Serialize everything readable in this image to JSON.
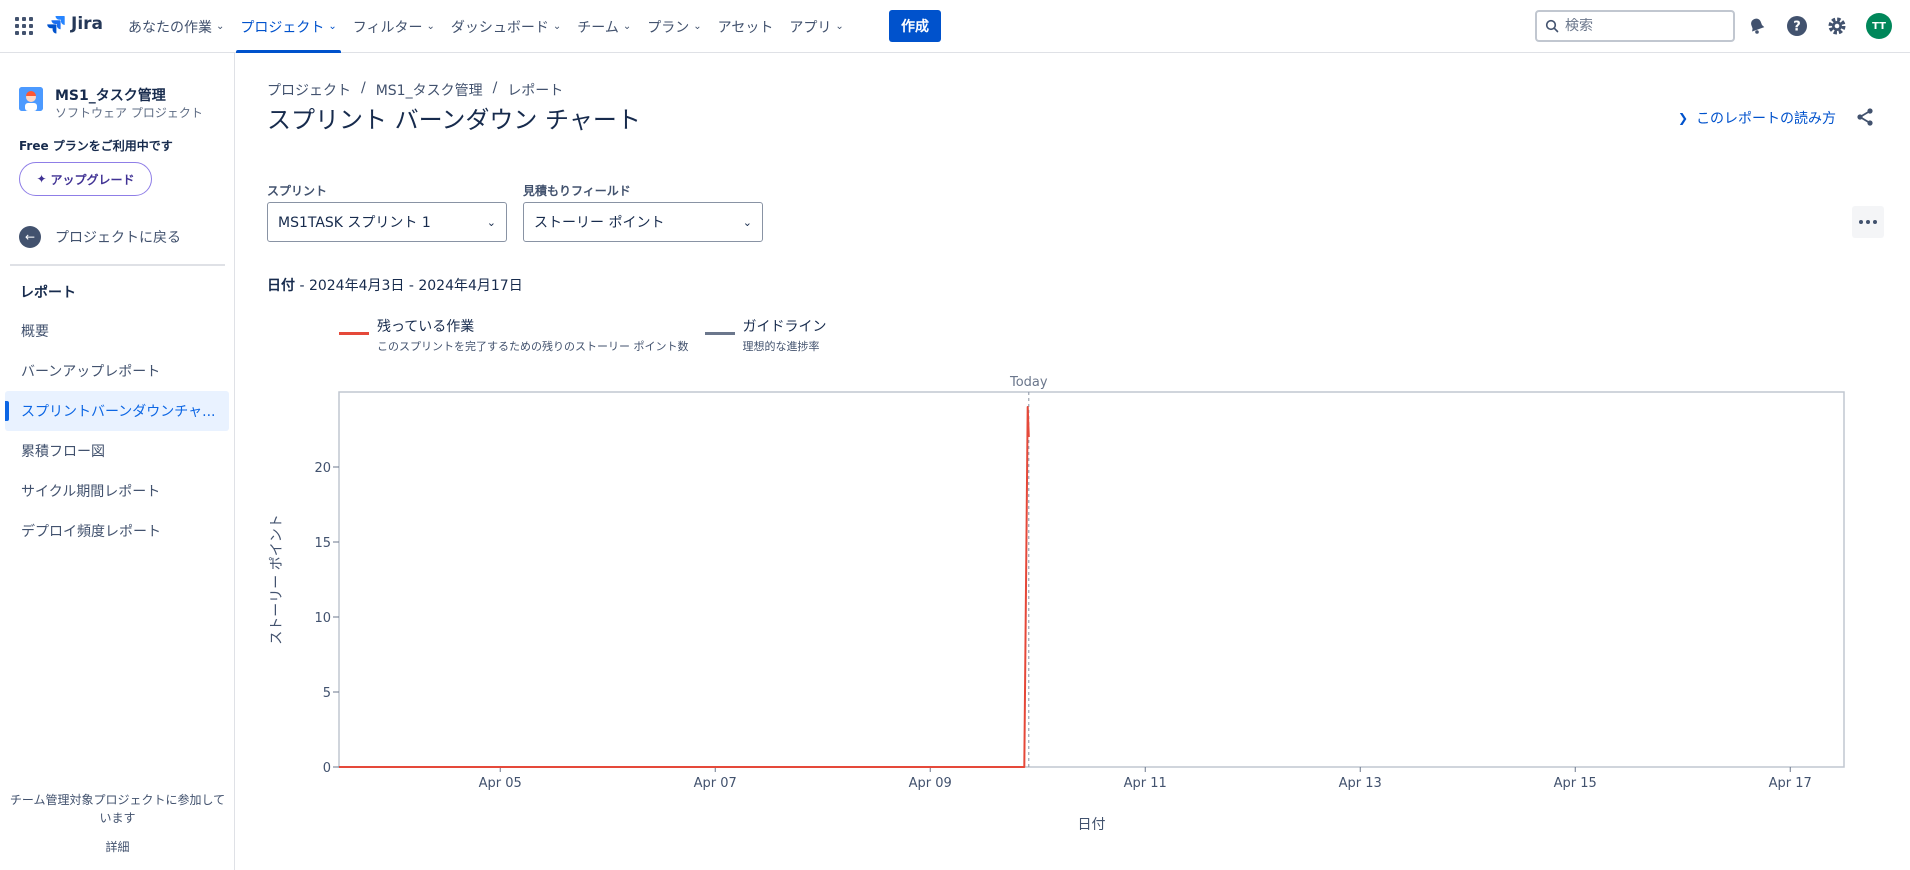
{
  "topnav": {
    "product": "Jira",
    "items": [
      {
        "label": "あなたの作業",
        "chevron": true,
        "active": false
      },
      {
        "label": "プロジェクト",
        "chevron": true,
        "active": true
      },
      {
        "label": "フィルター",
        "chevron": true,
        "active": false
      },
      {
        "label": "ダッシュボード",
        "chevron": true,
        "active": false
      },
      {
        "label": "チーム",
        "chevron": true,
        "active": false
      },
      {
        "label": "プラン",
        "chevron": true,
        "active": false
      },
      {
        "label": "アセット",
        "chevron": false,
        "active": false
      },
      {
        "label": "アプリ",
        "chevron": true,
        "active": false
      }
    ],
    "create_label": "作成",
    "search_placeholder": "検索",
    "avatar_initials": "TT",
    "icons": [
      "app-switcher-icon",
      "jira-logo-icon",
      "notification-bell-icon",
      "help-icon",
      "settings-icon"
    ]
  },
  "sidebar": {
    "project_name": "MS1_タスク管理",
    "project_type": "ソフトウェア プロジェクト",
    "plan_text": "Free プランをご利用中です",
    "upgrade_label": "アップグレード",
    "back_label": "プロジェクトに戻る",
    "section_heading": "レポート",
    "items": [
      {
        "label": "概要",
        "active": false
      },
      {
        "label": "バーンアップレポート",
        "active": false
      },
      {
        "label": "スプリントバーンダウンチャ...",
        "active": true
      },
      {
        "label": "累積フロー図",
        "active": false
      },
      {
        "label": "サイクル期間レポート",
        "active": false
      },
      {
        "label": "デプロイ頻度レポート",
        "active": false
      }
    ],
    "footer_text": "チーム管理対象プロジェクトに参加しています",
    "footer_link": "詳細"
  },
  "main": {
    "breadcrumb": [
      "プロジェクト",
      "MS1_タスク管理",
      "レポート"
    ],
    "title": "スプリント バーンダウン チャート",
    "help_link": "このレポートの読み方",
    "sprint_label": "スプリント",
    "sprint_value": "MS1TASK スプリント 1",
    "estimate_label": "見積もりフィールド",
    "estimate_value": "ストーリー ポイント",
    "date_label": "日付",
    "date_range": " - 2024年4月3日 - 2024年4月17日"
  },
  "colors": {
    "accent": "#0052cc",
    "remaining": "#e5493a",
    "guideline": "#6b778c",
    "avatar": "#00875a"
  },
  "chart_data": {
    "type": "line",
    "xlabel": "日付",
    "ylabel": "ストーリー ポイント",
    "x_range": [
      "2024-04-03 12:00",
      "2024-04-17 12:00"
    ],
    "ylim": [
      0,
      25
    ],
    "yticks": [
      0,
      5,
      10,
      15,
      20
    ],
    "xticks": [
      "Apr 05",
      "Apr 07",
      "Apr 09",
      "Apr 11",
      "Apr 13",
      "Apr 15",
      "Apr 17"
    ],
    "today_label": "Today",
    "today_date": "2024-04-09 22:00",
    "grid": false,
    "legend_position": "top-left",
    "series": [
      {
        "name": "残っている作業",
        "description": "このスプリントを完了するための残りのストーリー ポイント数",
        "color": "#e5493a",
        "points": [
          {
            "date": "2024-04-03 12:00",
            "value": 0
          },
          {
            "date": "2024-04-09 21:00",
            "value": 0
          },
          {
            "date": "2024-04-09 21:45",
            "value": 24
          },
          {
            "date": "2024-04-09 22:00",
            "value": 22
          }
        ]
      },
      {
        "name": "ガイドライン",
        "description": "理想的な進捗率",
        "color": "#6b778c",
        "points": []
      }
    ]
  }
}
